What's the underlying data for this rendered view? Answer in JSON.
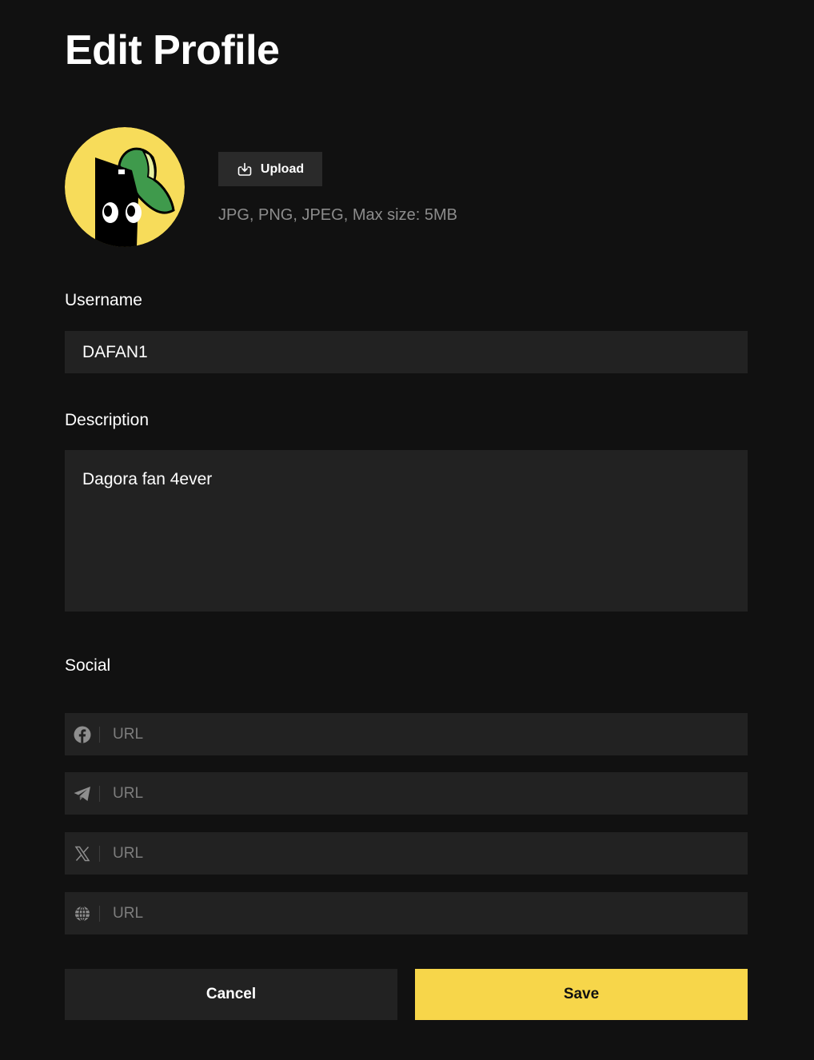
{
  "page": {
    "title": "Edit Profile"
  },
  "avatar": {
    "background_color": "#f7dc5a",
    "icon": "mascot-avatar"
  },
  "upload": {
    "label": "Upload",
    "icon": "upload-icon",
    "hint": "JPG, PNG, JPEG, Max size: 5MB"
  },
  "username": {
    "label": "Username",
    "value": "DAFAN1"
  },
  "description": {
    "label": "Description",
    "value": "Dagora fan 4ever"
  },
  "social": {
    "label": "Social",
    "links": [
      {
        "icon": "facebook-icon",
        "placeholder": "URL",
        "value": ""
      },
      {
        "icon": "telegram-icon",
        "placeholder": "URL",
        "value": ""
      },
      {
        "icon": "x-icon",
        "placeholder": "URL",
        "value": ""
      },
      {
        "icon": "globe-icon",
        "placeholder": "URL",
        "value": ""
      }
    ]
  },
  "actions": {
    "cancel_label": "Cancel",
    "save_label": "Save"
  },
  "colors": {
    "background": "#111111",
    "field_background": "#222222",
    "accent": "#f7d64a"
  }
}
